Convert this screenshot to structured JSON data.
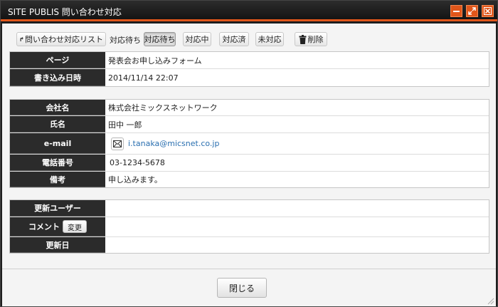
{
  "window": {
    "title": "SITE PUBLIS 問い合わせ対応"
  },
  "toolbar": {
    "back_label": "問い合わせ対応リスト",
    "status_label": "対応待ち",
    "status_buttons": [
      "対応待ち",
      "対応中",
      "対応済",
      "未対応"
    ],
    "active_status": "対応待ち",
    "delete_label": "削除"
  },
  "page_info": {
    "page_header": "ページ",
    "page_value": "発表会お申し込みフォーム",
    "date_header": "書き込み日時",
    "date_value": "2014/11/14 22:07"
  },
  "contact": {
    "company_header": "会社名",
    "company_value": "株式会社ミックスネットワーク",
    "name_header": "氏名",
    "name_value": "田中 一郎",
    "email_header": "e-mail",
    "email_value": "i.tanaka@micsnet.co.jp",
    "phone_header": "電話番号",
    "phone_value": "03-1234-5678",
    "note_header": "備考",
    "note_value": "申し込みます。"
  },
  "update": {
    "user_header": "更新ユーザー",
    "user_value": "",
    "comment_header": "コメント",
    "comment_button": "変更",
    "comment_value": "",
    "date_header": "更新日",
    "date_value": ""
  },
  "footer": {
    "close_label": "閉じる"
  },
  "colors": {
    "accent": "#e0561a",
    "header_bg": "#2b2b2b",
    "link": "#2a6fb0"
  }
}
